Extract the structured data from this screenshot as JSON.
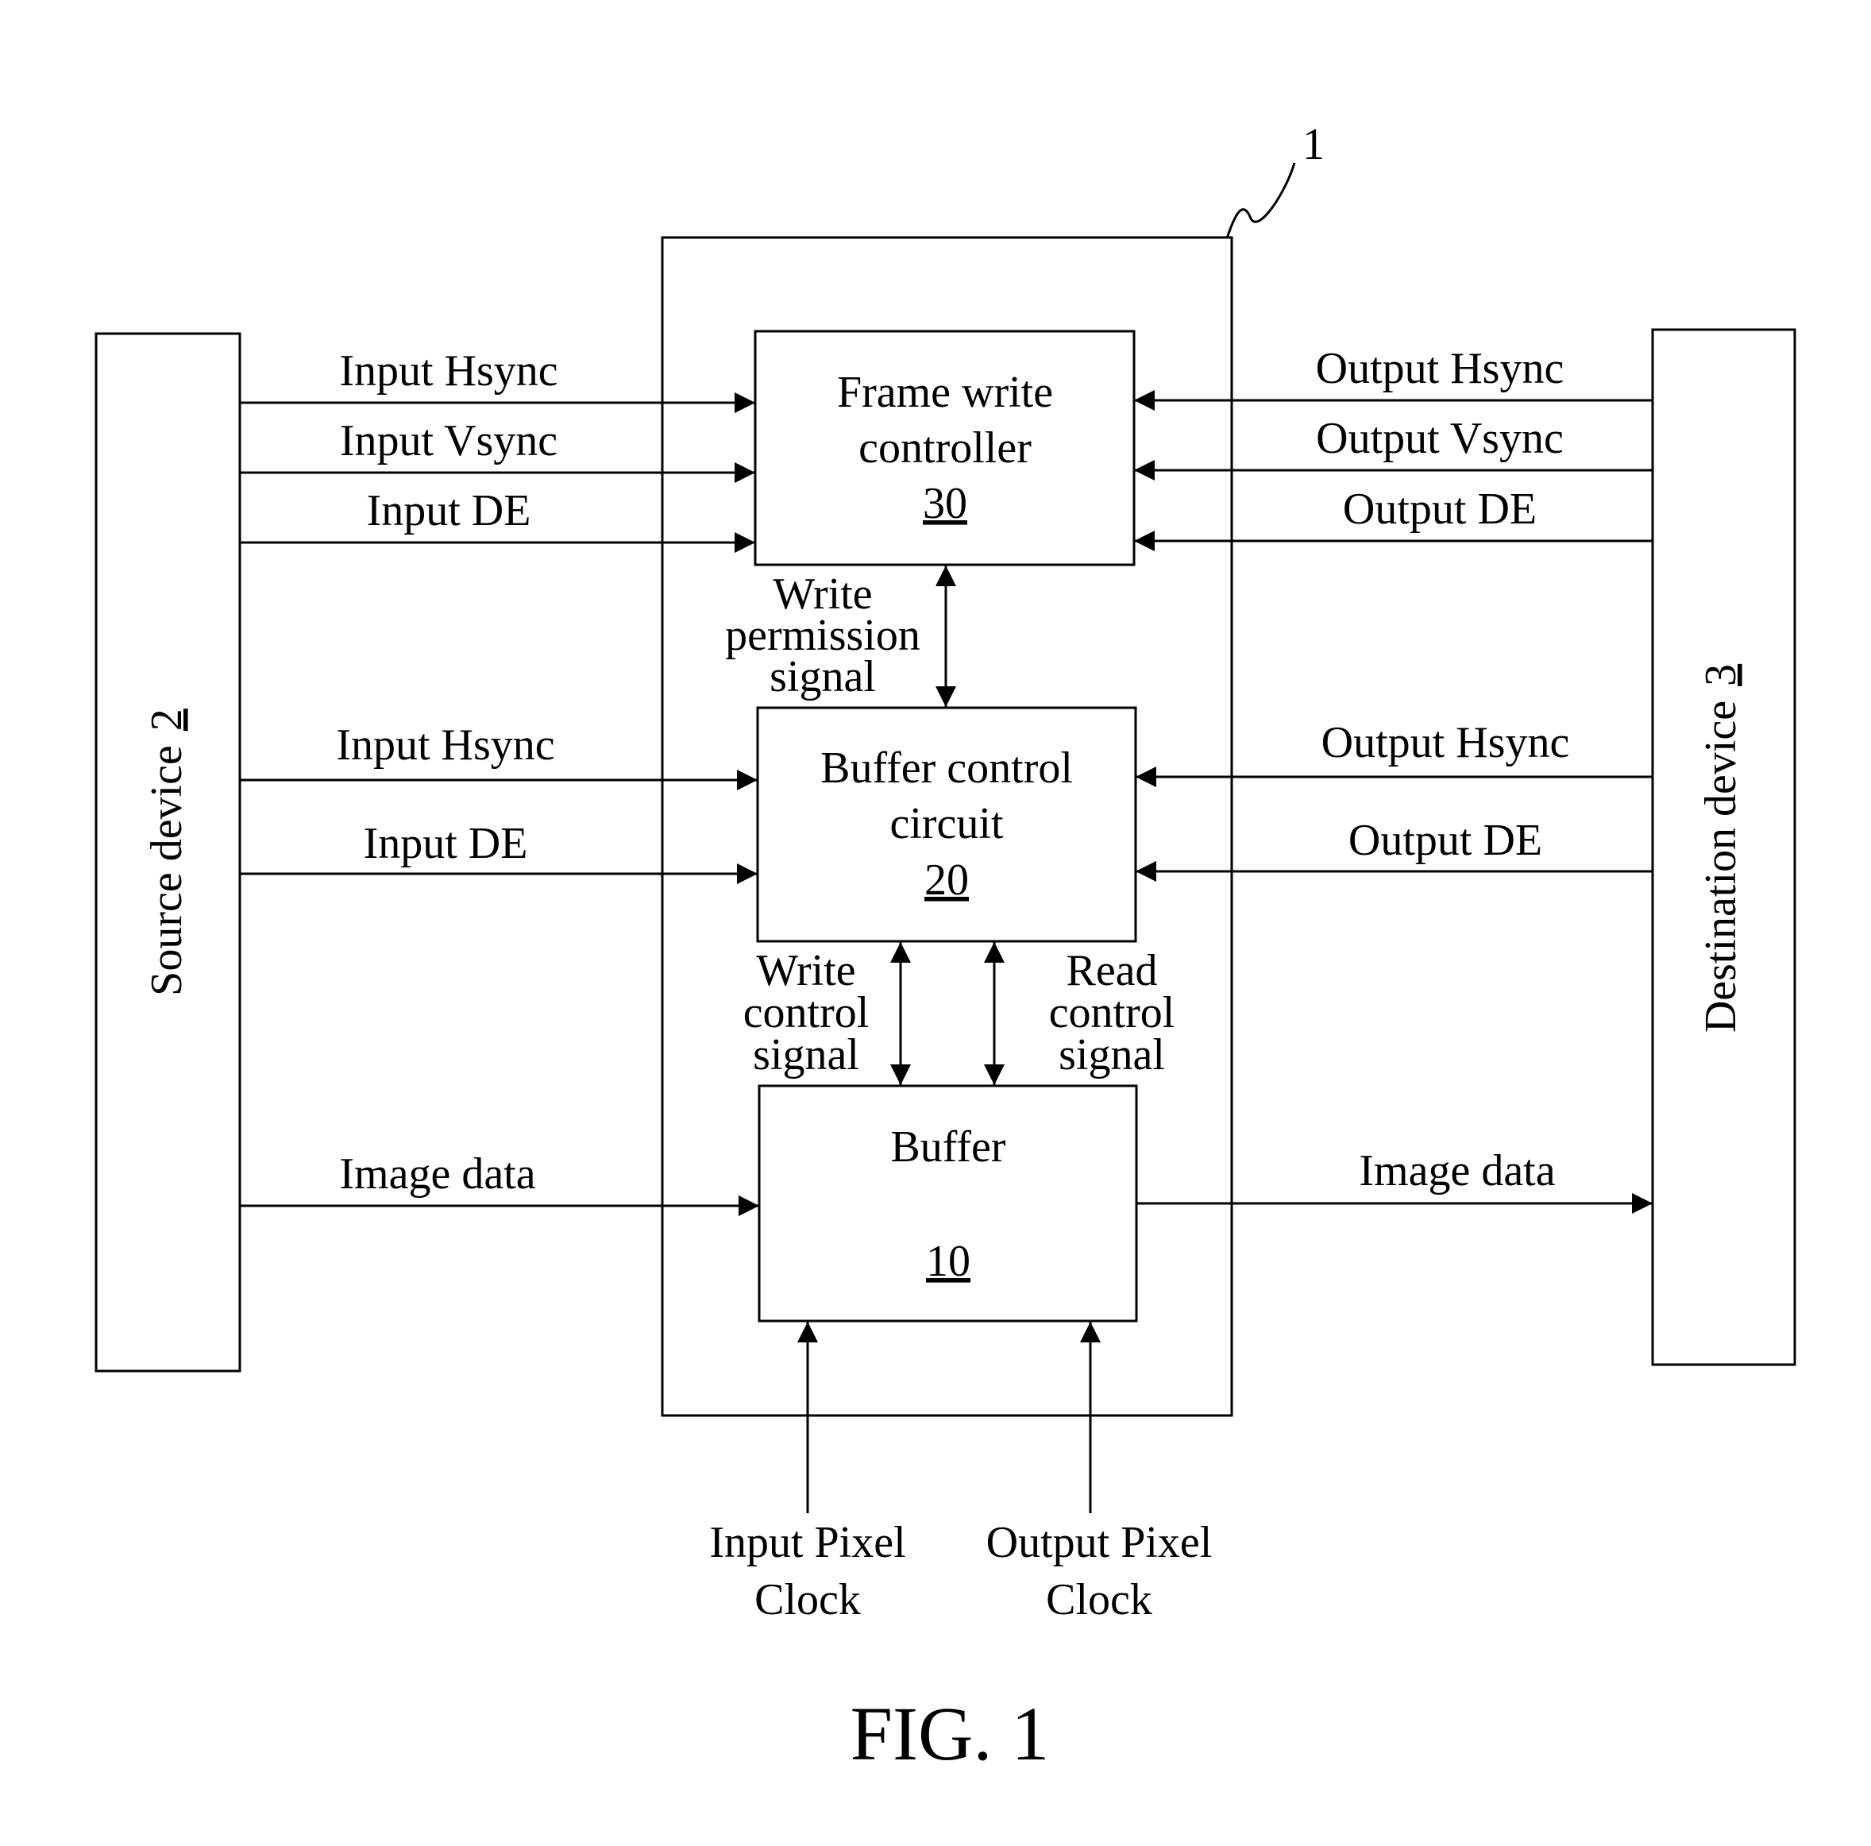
{
  "figure": {
    "caption": "FIG. 1",
    "system_ref": "1"
  },
  "colors": {
    "ink": "#000000",
    "background": "#ffffff"
  },
  "source_device": {
    "label": "Source device",
    "ref": "2"
  },
  "destination_device": {
    "label": "Destination device",
    "ref": "3"
  },
  "frame_write_controller": {
    "line1": "Frame write",
    "line2": "controller",
    "ref": "30"
  },
  "buffer_control_circuit": {
    "line1": "Buffer control",
    "line2": "circuit",
    "ref": "20"
  },
  "buffer": {
    "line1": "Buffer",
    "ref": "10"
  },
  "signals": {
    "fwc_inputs": [
      "Input Hsync",
      "Input Vsync",
      "Input DE"
    ],
    "fwc_outputs": [
      "Output Hsync",
      "Output Vsync",
      "Output DE"
    ],
    "bcc_inputs": [
      "Input Hsync",
      "Input DE"
    ],
    "bcc_outputs": [
      "Output Hsync",
      "Output DE"
    ],
    "image_in": "Image data",
    "image_out": "Image data",
    "write_permission": [
      "Write",
      "permission",
      "signal"
    ],
    "write_control": [
      "Write",
      "control",
      "signal"
    ],
    "read_control": [
      "Read",
      "control",
      "signal"
    ],
    "input_pixel_clock": [
      "Input Pixel",
      "Clock"
    ],
    "output_pixel_clock": [
      "Output Pixel",
      "Clock"
    ]
  }
}
